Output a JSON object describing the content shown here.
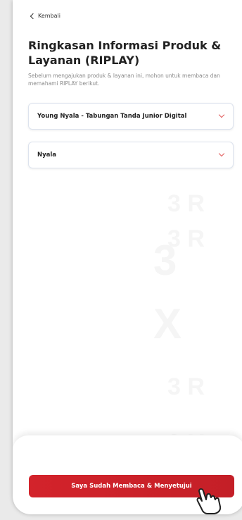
{
  "header": {
    "back_label": "Kembali",
    "title": "Ringkasan Informasi Produk & Layanan (RIPLAY)",
    "subtitle": "Sebelum mengajukan produk & layanan ini, mohon untuk membaca dan memahami RIPLAY berikut."
  },
  "selects": {
    "product": {
      "value": "Young Nyala - Tabungan Tanda Junior Digital"
    },
    "variant": {
      "value": "Nyala"
    }
  },
  "footer": {
    "agree_button_label": "Saya Sudah Membaca & Menyetujui"
  },
  "colors": {
    "accent": "#d3232b",
    "chevron": "#e25c5c"
  },
  "icons": [
    "back-chevron-icon",
    "chevron-down-icon",
    "pointer-hand-icon"
  ]
}
